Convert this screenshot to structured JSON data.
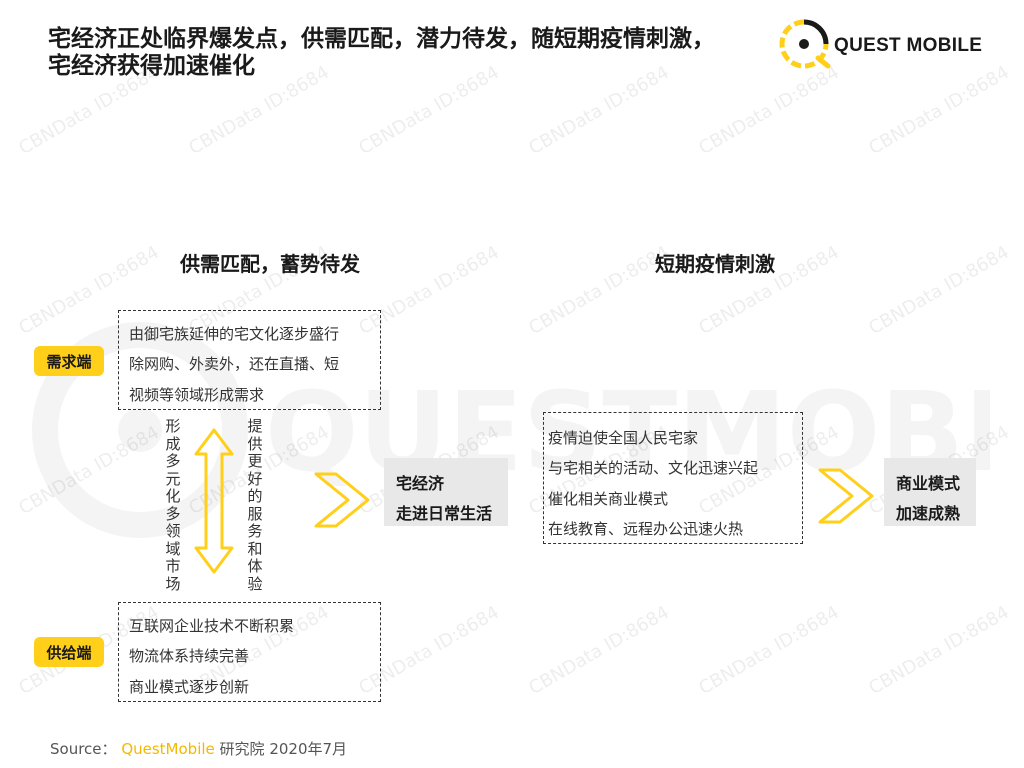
{
  "header": {
    "title_line1": "宅经济正处临界爆发点，供需匹配，潜力待发，随短期疫情刺激，",
    "title_line2": "宅经济获得加速催化",
    "logo_text": "QUEST MOBILE"
  },
  "left_section": {
    "title": "供需匹配，蓄势待发",
    "demand_tag": "需求端",
    "demand_lines": [
      "由御宅族延伸的宅文化逐步盛行",
      "除网购、外卖外，还在直播、短",
      "视频等领域形成需求"
    ],
    "supply_tag": "供给端",
    "supply_lines": [
      "互联网企业技术不断积累",
      "物流体系持续完善",
      "商业模式逐步创新"
    ],
    "vertical_left": "形成多元化多领域市场",
    "vertical_right": "提供更好的服务和体验",
    "result_lines": [
      "宅经济",
      "走进日常生活"
    ]
  },
  "right_section": {
    "title": "短期疫情刺激",
    "lines": [
      "疫情迫使全国人民宅家",
      "与宅相关的活动、文化迅速兴起",
      "催化相关商业模式",
      "在线教育、远程办公迅速火热"
    ],
    "result_lines": [
      "商业模式",
      "加速成熟"
    ]
  },
  "watermark": {
    "text": "CBNData ID:8684",
    "logo_text": "QUESTMOBILE"
  },
  "footer": {
    "source_label": "Source：",
    "source_brand": "QuestMobile",
    "source_rest": " 研究院 2020年7月"
  },
  "colors": {
    "accent": "#FFCF1A",
    "result_bg": "#E8E8E8"
  }
}
